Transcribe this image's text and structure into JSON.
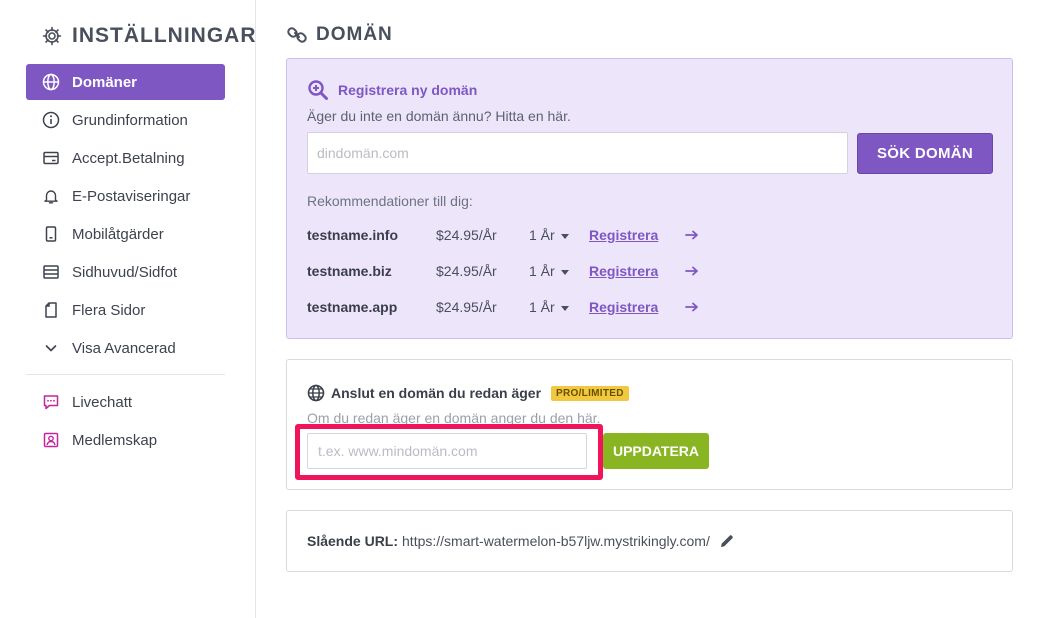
{
  "sidebar": {
    "title": "INSTÄLLNINGAR",
    "title_icon": "gear-icon",
    "items": [
      {
        "label": "Domäner",
        "icon": "globe-icon",
        "active": true
      },
      {
        "label": "Grundinformation",
        "icon": "info-icon"
      },
      {
        "label": "Accept.Betalning",
        "icon": "credit-card-icon"
      },
      {
        "label": "E-Postaviseringar",
        "icon": "bell-icon"
      },
      {
        "label": "Mobilåtgärder",
        "icon": "mobile-icon"
      },
      {
        "label": "Sidhuvud/Sidfot",
        "icon": "layout-icon"
      },
      {
        "label": "Flera Sidor",
        "icon": "pages-icon"
      },
      {
        "label": "Visa Avancerad",
        "icon": "chevron-down-icon"
      }
    ],
    "extra_items": [
      {
        "label": "Livechatt",
        "icon": "chat-icon"
      },
      {
        "label": "Medlemskap",
        "icon": "member-icon"
      }
    ]
  },
  "main": {
    "title": "DOMÄN",
    "title_icon": "link-icon",
    "register": {
      "heading": "Registrera ny domän",
      "subtitle": "Äger du inte en domän ännu? Hitta en här.",
      "input_placeholder": "dindomän.com",
      "button": "SÖK DOMÄN",
      "recommendations_label": "Rekommendationer till dig:",
      "recommendations": [
        {
          "name": "testname.info",
          "price": "$24.95/År",
          "term": "1 År",
          "action": "Registrera"
        },
        {
          "name": "testname.biz",
          "price": "$24.95/År",
          "term": "1 År",
          "action": "Registrera"
        },
        {
          "name": "testname.app",
          "price": "$24.95/År",
          "term": "1 År",
          "action": "Registrera"
        }
      ]
    },
    "connect": {
      "heading": "Anslut en domän du redan äger",
      "badge": "PRO/LIMITED",
      "subtitle": "Om du redan äger en domän anger du den här.",
      "input_placeholder": "t.ex. www.mindomän.com",
      "button": "UPPDATERA"
    },
    "url": {
      "label": "Slående URL:",
      "value": "https://smart-watermelon-b57ljw.mystrikingly.com/"
    }
  },
  "colors": {
    "accent": "#7e57c2",
    "register_bg": "#ede6fb",
    "update_button": "#8ab522",
    "badge": "#f0c940",
    "highlight": "#f0145a"
  }
}
